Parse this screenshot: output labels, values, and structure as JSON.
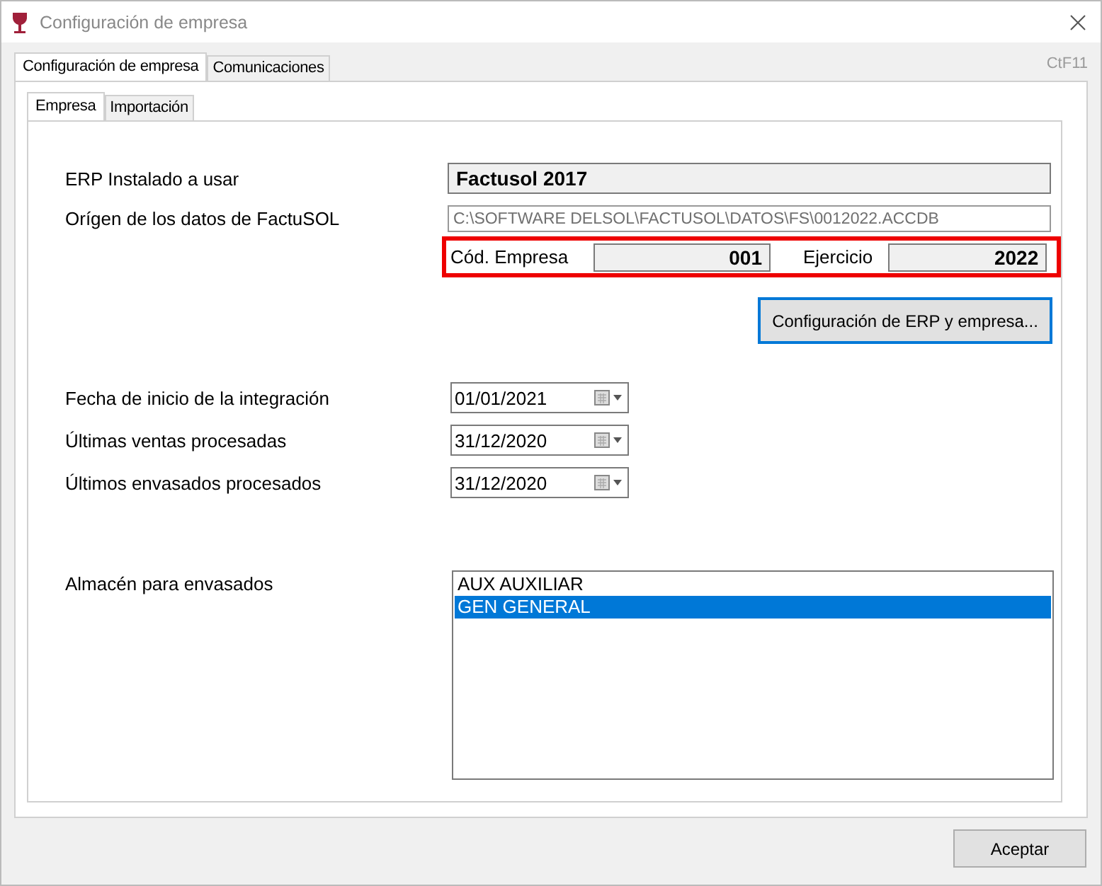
{
  "window": {
    "title": "Configuración de empresa"
  },
  "shortcut": "CtF11",
  "tabs": [
    {
      "label": "Configuración de empresa",
      "selected": true
    },
    {
      "label": "Comunicaciones",
      "selected": false
    }
  ],
  "subtabs": [
    {
      "label": "Empresa",
      "selected": true
    },
    {
      "label": "Importación",
      "selected": false
    }
  ],
  "erp": {
    "label": "ERP Instalado a usar",
    "value": "Factusol 2017"
  },
  "source": {
    "label": "Orígen de los datos de FactuSOL",
    "value": "C:\\SOFTWARE DELSOL\\FACTUSOL\\DATOS\\FS\\0012022.ACCDB"
  },
  "company_code": {
    "label": "Cód. Empresa",
    "value": "001"
  },
  "fiscal_year": {
    "label": "Ejercicio",
    "value": "2022"
  },
  "config_button": "Configuración de ERP y empresa...",
  "dates": [
    {
      "label": "Fecha de inicio de la integración",
      "value": "01/01/2021"
    },
    {
      "label": "Últimas ventas procesadas",
      "value": "31/12/2020"
    },
    {
      "label": "Últimos envasados procesados",
      "value": "31/12/2020"
    }
  ],
  "warehouse": {
    "label": "Almacén para envasados",
    "items": [
      {
        "label": "AUX AUXILIAR",
        "selected": false
      },
      {
        "label": "GEN GENERAL",
        "selected": true
      }
    ]
  },
  "buttons": [
    "Aceptar"
  ]
}
